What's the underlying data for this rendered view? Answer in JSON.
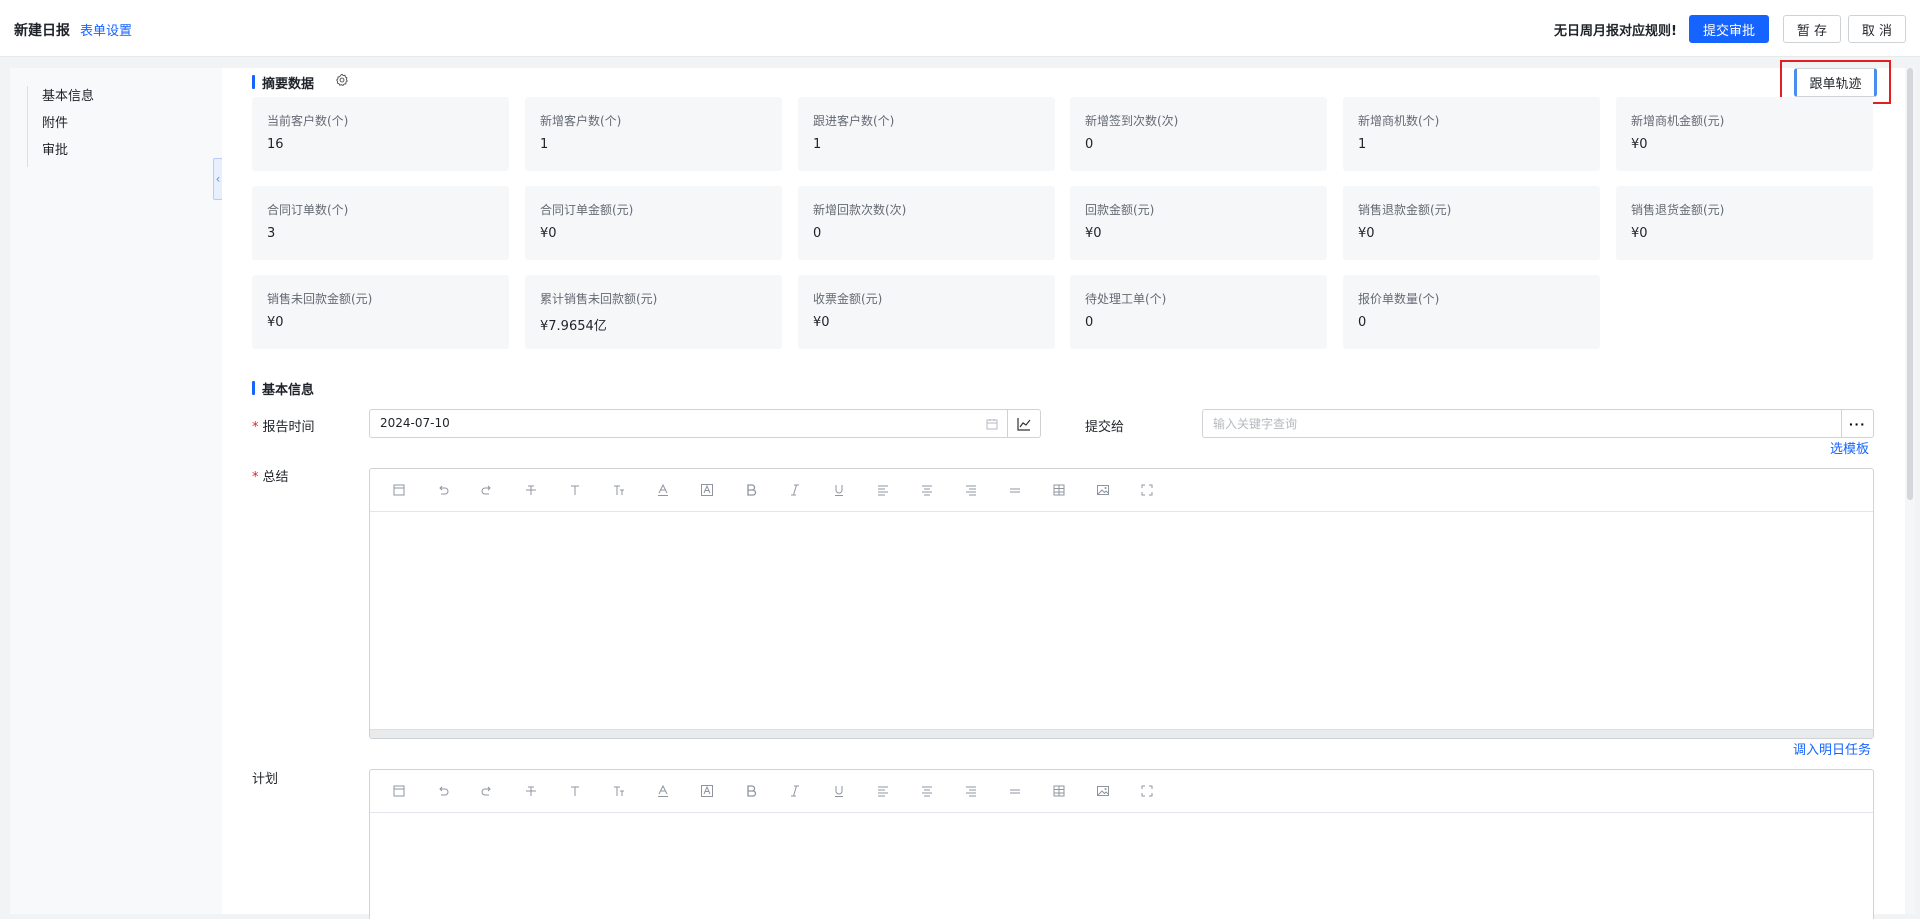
{
  "header": {
    "page_title": "新建日报",
    "form_settings_link": "表单设置",
    "no_rule_notice": "无日周月报对应规则!",
    "submit_button": "提交审批",
    "save_button": "暂 存",
    "cancel_button": "取 消"
  },
  "sidebar": {
    "items": [
      {
        "label": "基本信息"
      },
      {
        "label": "附件"
      },
      {
        "label": "审批"
      }
    ],
    "collapse_glyph": "‹"
  },
  "summary": {
    "title": "摘要数据",
    "trail_button": "跟单轨迹",
    "stats": [
      {
        "label": "当前客户数(个)",
        "value": "16"
      },
      {
        "label": "新增客户数(个)",
        "value": "1"
      },
      {
        "label": "跟进客户数(个)",
        "value": "1"
      },
      {
        "label": "新增签到次数(次)",
        "value": "0"
      },
      {
        "label": "新增商机数(个)",
        "value": "1"
      },
      {
        "label": "新增商机金额(元)",
        "value": "¥0"
      },
      {
        "label": "合同订单数(个)",
        "value": "3"
      },
      {
        "label": "合同订单金额(元)",
        "value": "¥0"
      },
      {
        "label": "新增回款次数(次)",
        "value": "0"
      },
      {
        "label": "回款金额(元)",
        "value": "¥0"
      },
      {
        "label": "销售退款金额(元)",
        "value": "¥0"
      },
      {
        "label": "销售退货金额(元)",
        "value": "¥0"
      },
      {
        "label": "销售未回款金额(元)",
        "value": "¥0"
      },
      {
        "label": "累计销售未回款额(元)",
        "value": "¥7.9654亿"
      },
      {
        "label": "收票金额(元)",
        "value": "¥0"
      },
      {
        "label": "待处理工单(个)",
        "value": "0"
      },
      {
        "label": "报价单数量(个)",
        "value": "0"
      }
    ]
  },
  "basic_info": {
    "title": "基本信息",
    "required_mark": "*",
    "report_time_label": "报告时间",
    "report_time_value": "2024-07-10",
    "submit_to_label": "提交给",
    "submit_to_placeholder": "输入关键字查询",
    "more_button": "···",
    "select_template_link": "选模板",
    "summary_label": "总结",
    "import_tomorrow_link": "调入明日任务",
    "plan_label": "计划"
  },
  "colors": {
    "primary": "#1664ff",
    "highlight": "#e02020"
  }
}
